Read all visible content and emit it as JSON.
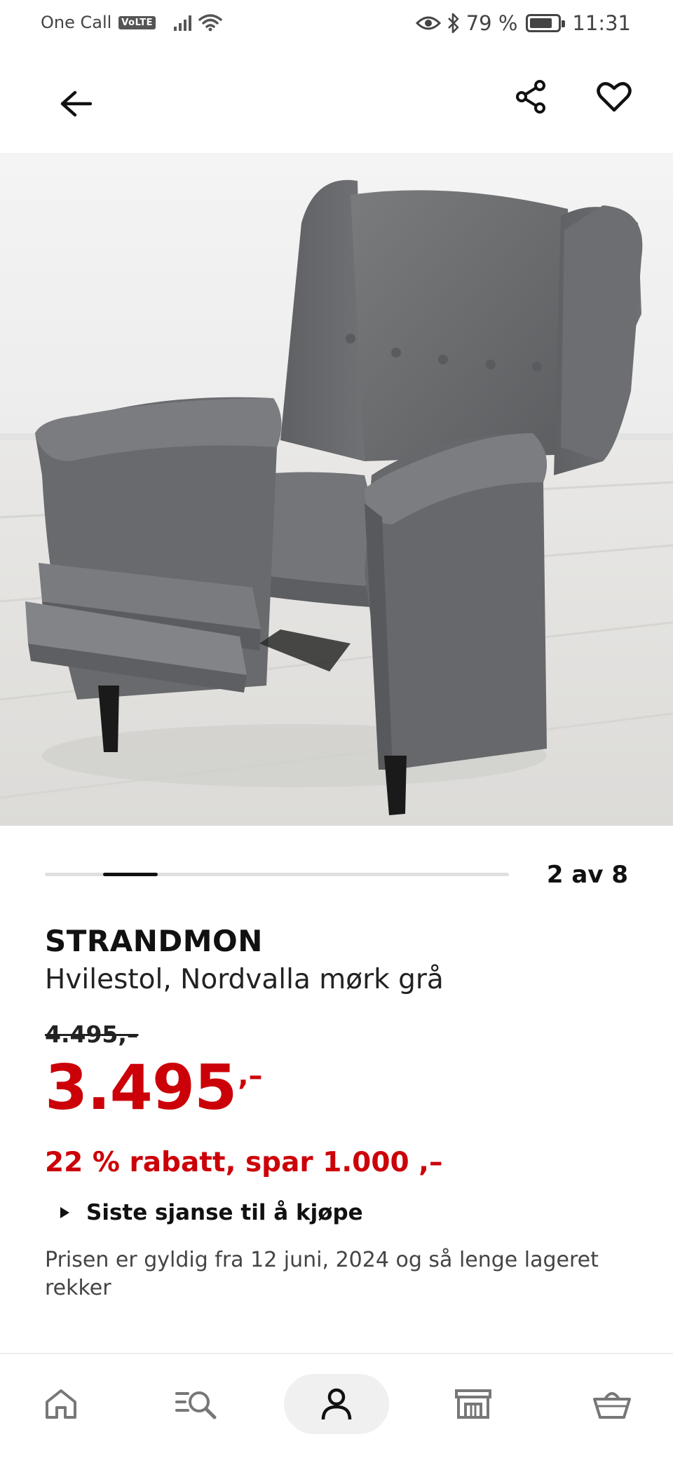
{
  "status_bar": {
    "carrier": "One Call",
    "volte": "VoLTE",
    "battery": "79 %",
    "time": "11:31",
    "icons": [
      "signal-icon",
      "wifi-icon",
      "eye-icon",
      "bluetooth-icon",
      "battery-icon"
    ]
  },
  "top_bar": {
    "icons": [
      "back-arrow-icon",
      "share-icon",
      "heart-icon"
    ]
  },
  "gallery": {
    "counter": "2 av 8",
    "current": 2,
    "total": 8
  },
  "product": {
    "name": "STRANDMON",
    "description": "Hvilestol, Nordvalla mørk grå",
    "old_price": "4.495,–",
    "price": "3.495",
    "price_suffix": ",–",
    "discount": "22 % rabatt, spar 1.000 ,–",
    "last_chance": "Siste sjanse til å kjøpe",
    "validity": "Prisen er gyldig fra 12 juni, 2024 og så lenge lageret rekker"
  },
  "bottom_nav": {
    "items": [
      {
        "name": "home",
        "icon": "home-icon"
      },
      {
        "name": "search",
        "icon": "search-icon"
      },
      {
        "name": "profile",
        "icon": "profile-icon",
        "active": true
      },
      {
        "name": "store",
        "icon": "store-icon"
      },
      {
        "name": "cart",
        "icon": "basket-icon"
      }
    ]
  },
  "colors": {
    "price_red": "#cc0008",
    "text": "#111111",
    "chair_fabric": "#6e6f71",
    "background": "#ffffff"
  }
}
